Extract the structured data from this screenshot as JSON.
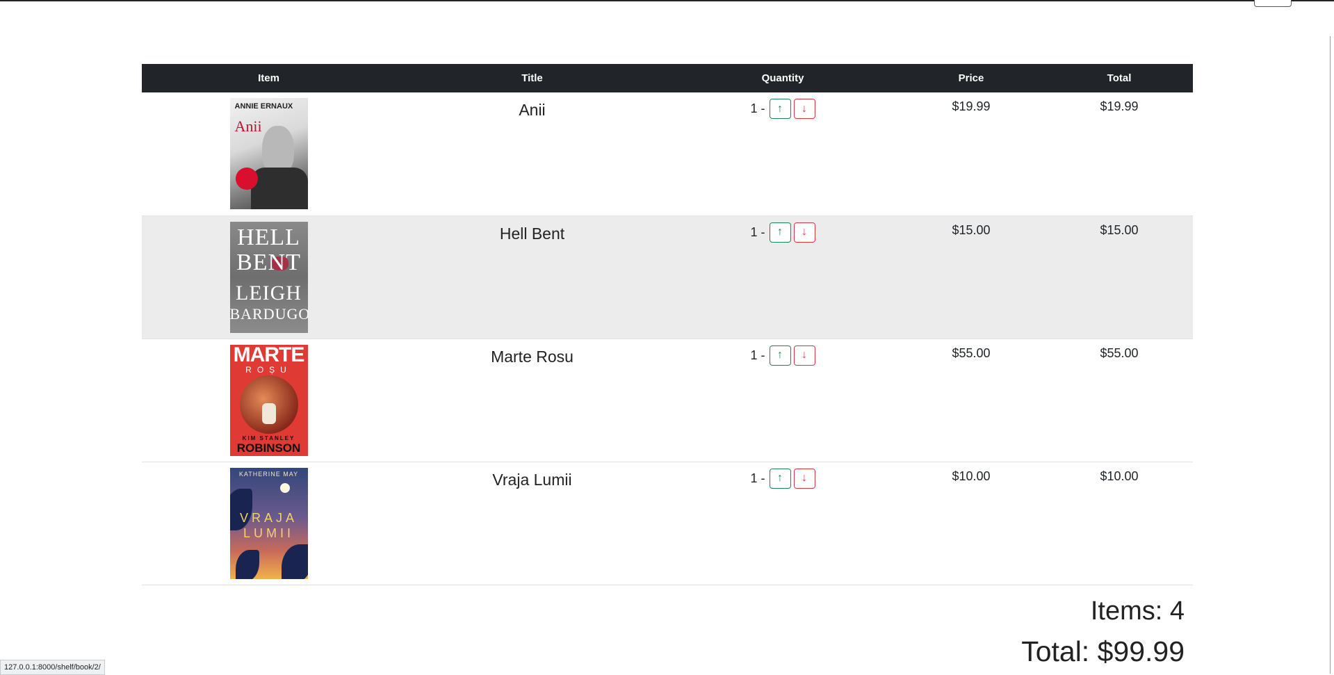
{
  "table": {
    "headers": [
      "Item",
      "Title",
      "Quantity",
      "Price",
      "Total"
    ],
    "rows": [
      {
        "cover": {
          "author": "ANNIE ERNAUX",
          "title": "Anii"
        },
        "title": "Anii",
        "quantity": "1 -",
        "price": "$19.99",
        "total": "$19.99"
      },
      {
        "cover": {
          "title_line_1": "HELL",
          "title_line_2": "BENT",
          "author_line_1": "LEIGH",
          "author_line_2": "BARDUGO"
        },
        "title": "Hell Bent",
        "quantity": "1 -",
        "price": "$15.00",
        "total": "$15.00"
      },
      {
        "cover": {
          "title_line_1": "MARTE",
          "title_line_2": "ROȘU",
          "author_line_1": "KIM STANLEY",
          "author_line_2": "ROBINSON"
        },
        "title": "Marte Rosu",
        "quantity": "1 -",
        "price": "$55.00",
        "total": "$55.00"
      },
      {
        "cover": {
          "author": "KATHERINE MAY",
          "title_line_1": "VRAJA",
          "title_line_2": "LUMII"
        },
        "title": "Vraja Lumii",
        "quantity": "1 -",
        "price": "$10.00",
        "total": "$10.00"
      }
    ],
    "increment_glyph": "↑",
    "decrement_glyph": "↓"
  },
  "summary": {
    "items": "Items: 4",
    "total": "Total: $99.99"
  },
  "status_bar": {
    "link_url": "127.0.0.1:8000/shelf/book/2/"
  },
  "colors": {
    "header_bg": "#212529",
    "increment": "#198754",
    "decrement": "#dc3545"
  }
}
